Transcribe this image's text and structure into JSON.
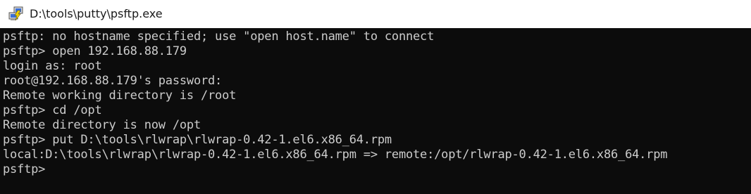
{
  "window": {
    "title": "D:\\tools\\putty\\psftp.exe",
    "icon": "putty-psftp-icon"
  },
  "colors": {
    "background": "#0c0c0c",
    "foreground": "#cccccc",
    "titlebar": "#ffffff"
  },
  "console": {
    "lines": [
      "psftp: no hostname specified; use \"open host.name\" to connect",
      "psftp> open 192.168.88.179",
      "login as: root",
      "root@192.168.88.179's password:",
      "Remote working directory is /root",
      "psftp> cd /opt",
      "Remote directory is now /opt",
      "psftp> put D:\\tools\\rlwrap\\rlwrap-0.42-1.el6.x86_64.rpm",
      "local:D:\\tools\\rlwrap\\rlwrap-0.42-1.el6.x86_64.rpm => remote:/opt/rlwrap-0.42-1.el6.x86_64.rpm",
      "psftp>"
    ]
  }
}
